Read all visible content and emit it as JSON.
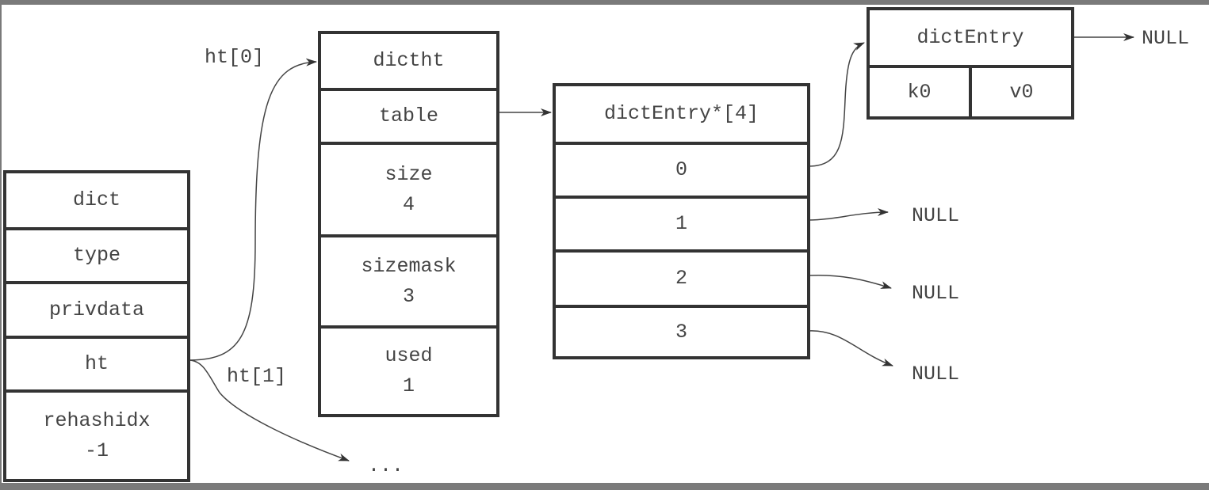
{
  "dict": {
    "title": "dict",
    "fields": [
      "type",
      "privdata",
      "ht"
    ],
    "rehashidx": {
      "name": "rehashidx",
      "value": "-1"
    }
  },
  "dictht": {
    "title": "dictht",
    "table": "table",
    "size": {
      "name": "size",
      "value": "4"
    },
    "sizemask": {
      "name": "sizemask",
      "value": "3"
    },
    "used": {
      "name": "used",
      "value": "1"
    }
  },
  "table_array": {
    "title": "dictEntry*[4]",
    "slots": [
      "0",
      "1",
      "2",
      "3"
    ]
  },
  "entry": {
    "title": "dictEntry",
    "key": "k0",
    "value": "v0",
    "next": "NULL"
  },
  "labels": {
    "ht0": "ht[0]",
    "ht1": "ht[1]",
    "ellipsis": "...",
    "null1": "NULL",
    "null2": "NULL",
    "null3": "NULL"
  }
}
